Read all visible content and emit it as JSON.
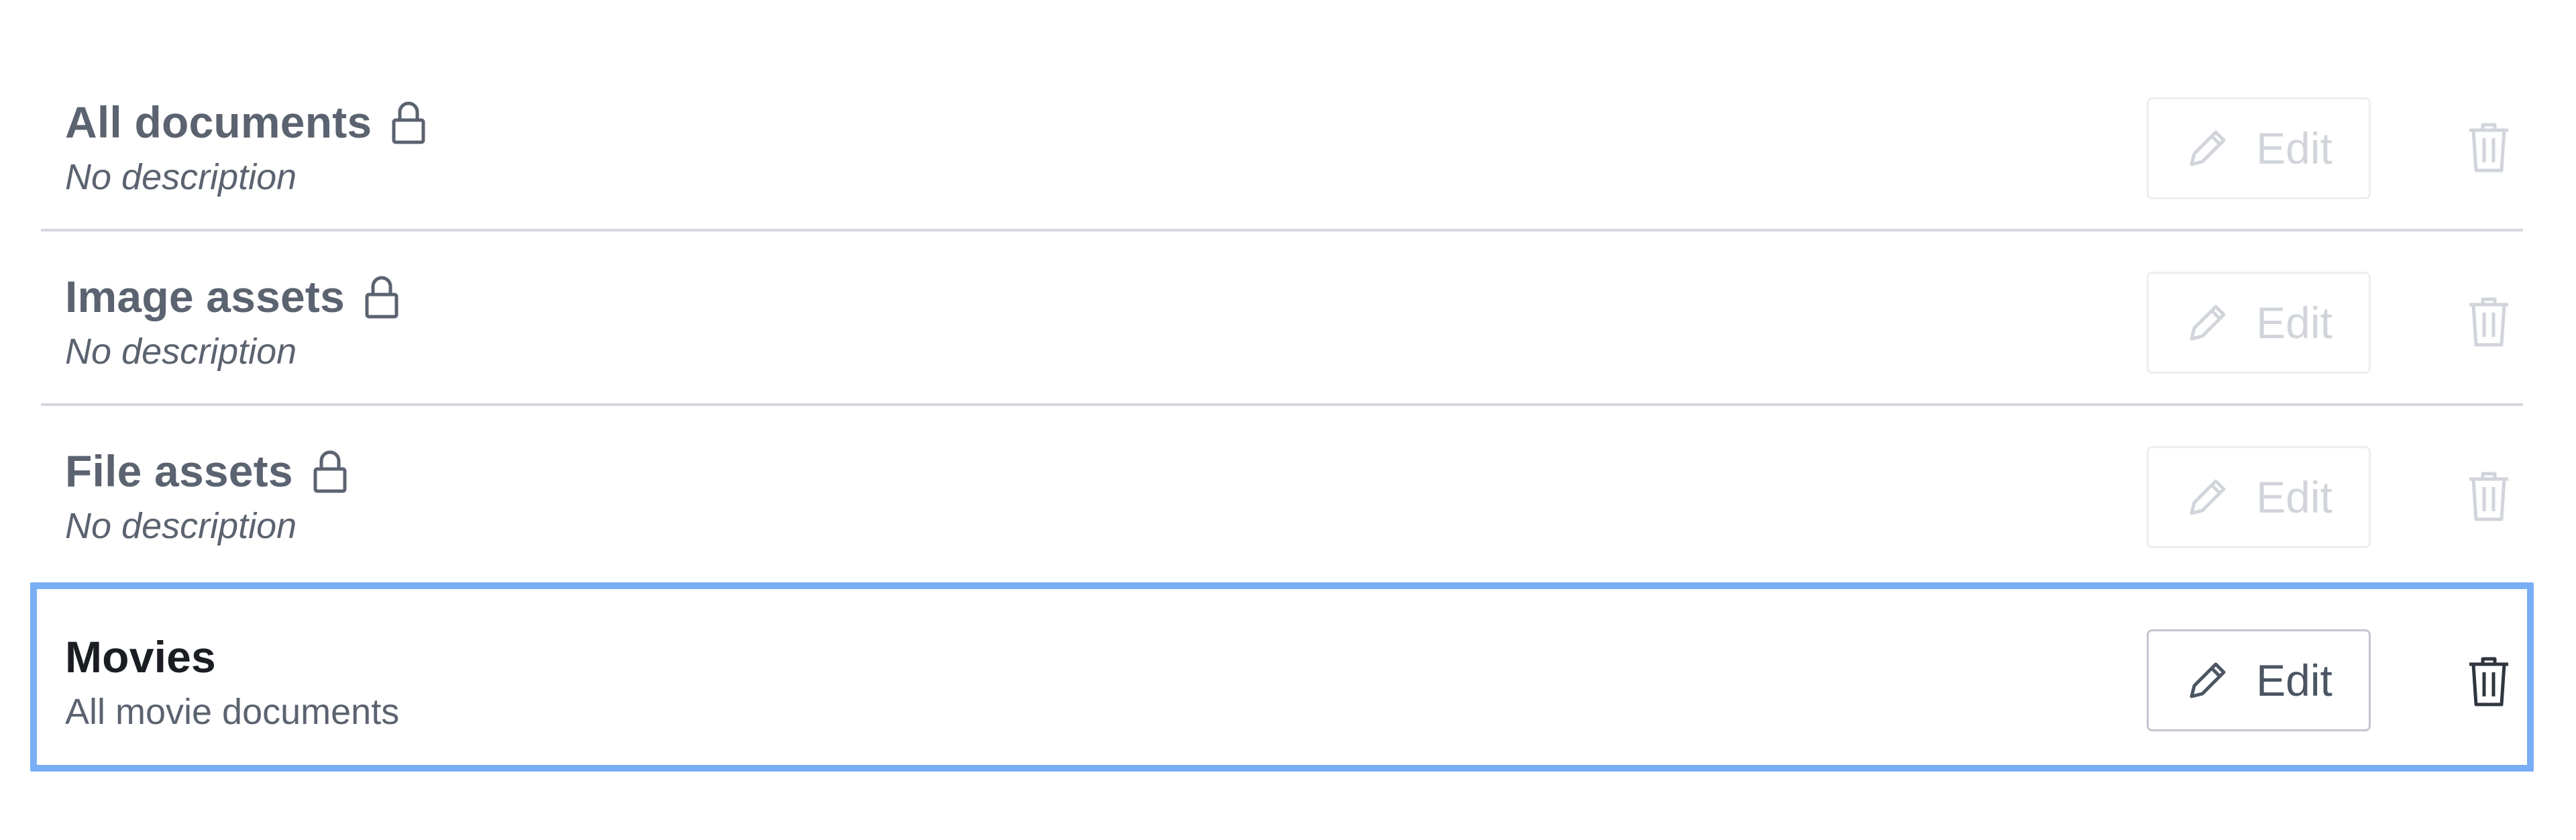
{
  "rows": [
    {
      "title": "All documents",
      "description": "No description",
      "locked": true,
      "edit_label": "Edit",
      "enabled": false
    },
    {
      "title": "Image assets",
      "description": "No description",
      "locked": true,
      "edit_label": "Edit",
      "enabled": false
    },
    {
      "title": "File assets",
      "description": "No description",
      "locked": true,
      "edit_label": "Edit",
      "enabled": false
    },
    {
      "title": "Movies",
      "description": "All movie documents",
      "locked": false,
      "edit_label": "Edit",
      "enabled": true
    }
  ],
  "icons": {
    "lock": "lock-icon",
    "pencil": "pencil-icon",
    "trash": "trash-icon"
  },
  "colors": {
    "selection_border": "#7aaef4",
    "disabled": "#d1d5db",
    "enabled_text": "#4b5563",
    "title": "#5b6370",
    "selected_title": "#1a1d22",
    "divider": "#d4d7dd"
  }
}
